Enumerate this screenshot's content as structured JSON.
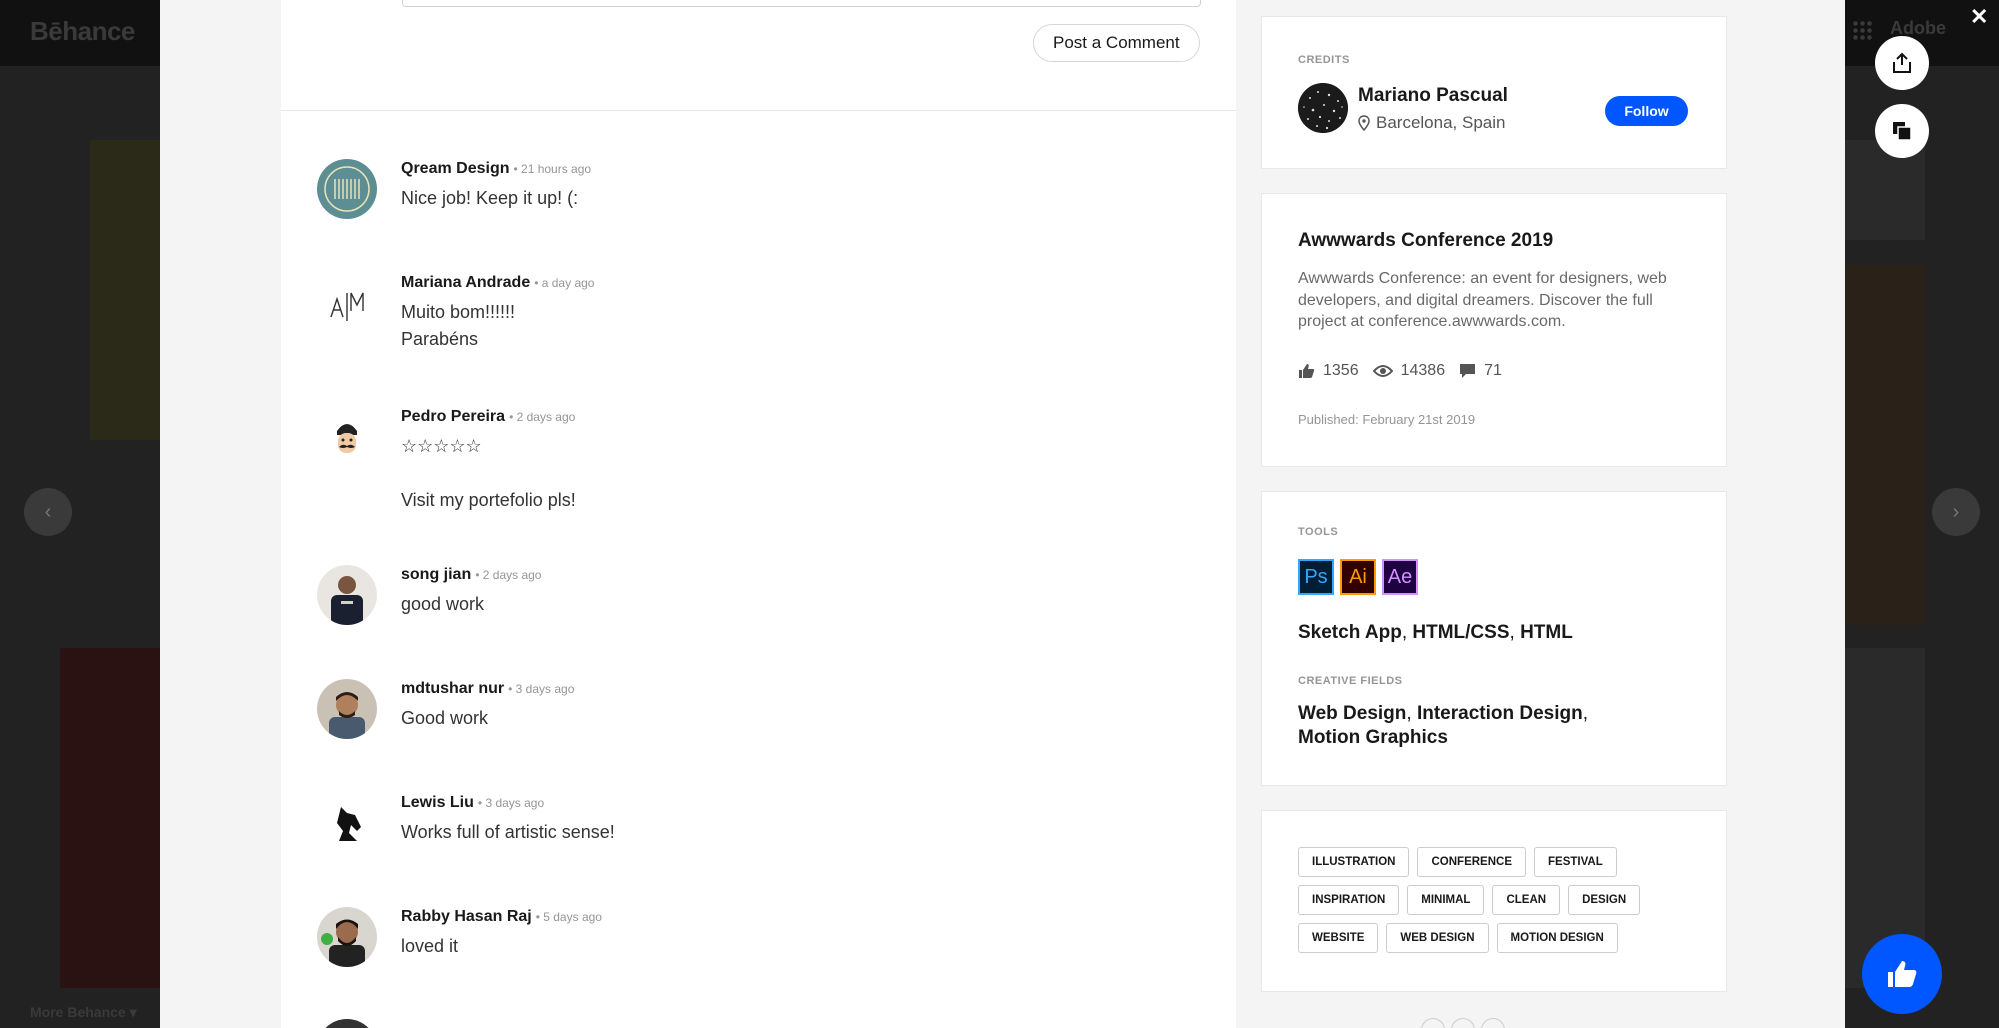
{
  "background": {
    "logo": "Bēhance",
    "adobe": "Adobe",
    "more_behance": "More Behance ▾"
  },
  "comment_form": {
    "post_button": "Post a Comment"
  },
  "comments": [
    {
      "name": "Qream Design",
      "time": "• 21 hours ago",
      "text": "Nice job! Keep it up! (:"
    },
    {
      "name": "Mariana Andrade",
      "time": "• a day ago",
      "text": "Muito bom!!!!!!\nParabéns"
    },
    {
      "name": "Pedro Pereira",
      "time": "• 2 days ago",
      "text": "☆☆☆☆☆\n\nVisit my portefolio pls!"
    },
    {
      "name": "song jian",
      "time": "• 2 days ago",
      "text": "good work"
    },
    {
      "name": "mdtushar nur",
      "time": "• 3 days ago",
      "text": "Good work"
    },
    {
      "name": "Lewis Liu",
      "time": "• 3 days ago",
      "text": "Works full of artistic sense!"
    },
    {
      "name": "Rabby Hasan Raj",
      "time": "• 5 days ago",
      "text": "loved it"
    }
  ],
  "credits": {
    "label": "CREDITS",
    "owner_name": "Mariano Pascual",
    "location": "Barcelona, Spain",
    "follow_label": "Follow"
  },
  "project": {
    "title": "Awwwards Conference 2019",
    "description": "Awwwards Conference: an event for designers, web developers, and digital dreamers. Discover the full project at conference.awwwards.com.",
    "appreciations": "1356",
    "views": "14386",
    "comments": "71",
    "published": "Published: February 21st 2019"
  },
  "tools": {
    "label": "TOOLS",
    "icons": [
      {
        "abbr": "Ps",
        "color": "#31a8ff",
        "bg": "#001e36"
      },
      {
        "abbr": "Ai",
        "color": "#ff9a00",
        "bg": "#330000"
      },
      {
        "abbr": "Ae",
        "color": "#d291ff",
        "bg": "#1f0040"
      }
    ],
    "names": [
      "Sketch App",
      "HTML/CSS",
      "HTML"
    ],
    "fields_label": "CREATIVE FIELDS",
    "fields": [
      "Web Design",
      "Interaction Design",
      "Motion Graphics"
    ]
  },
  "tags": [
    [
      "ILLUSTRATION",
      "CONFERENCE",
      "FESTIVAL"
    ],
    [
      "INSPIRATION",
      "MINIMAL",
      "CLEAN",
      "DESIGN"
    ],
    [
      "WEBSITE",
      "WEB DESIGN",
      "MOTION DESIGN"
    ]
  ],
  "colors": {
    "accent": "#0057ff"
  }
}
